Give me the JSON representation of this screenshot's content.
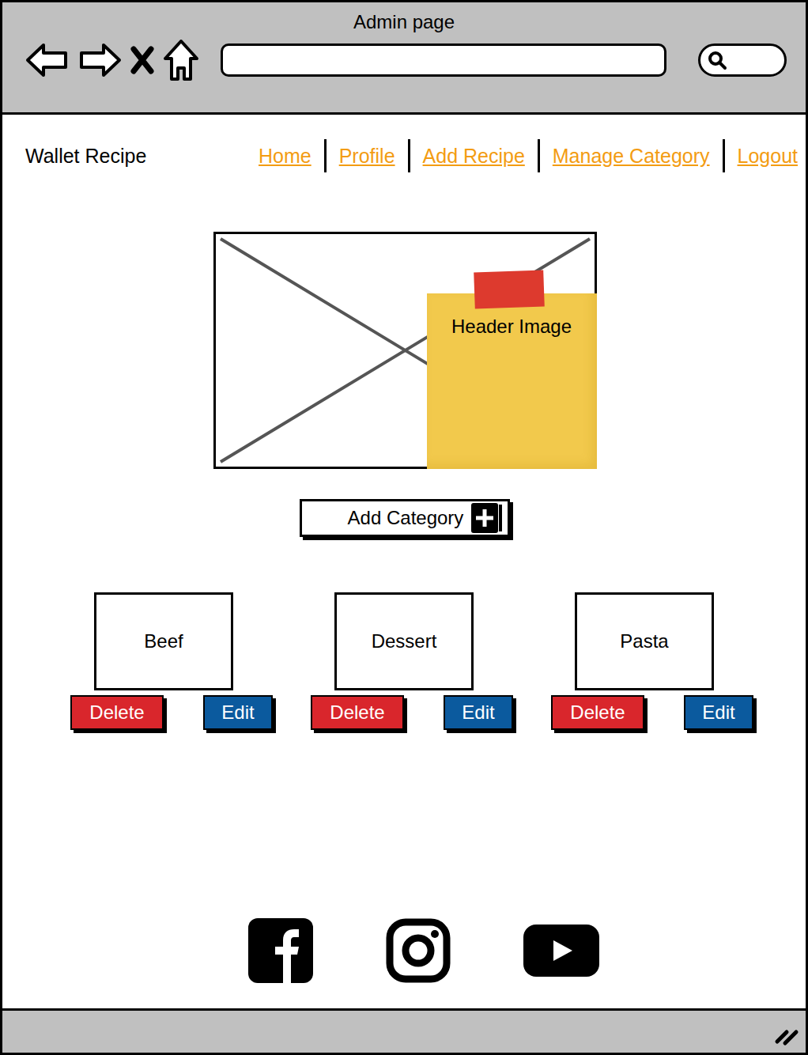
{
  "window": {
    "title": "Admin page"
  },
  "brand": "Wallet Recipe",
  "nav": [
    "Home",
    "Profile",
    "Add Recipe",
    "Manage Category",
    "Logout"
  ],
  "header_image": {
    "label": "Header Image"
  },
  "add_button": {
    "label": "Add Category"
  },
  "categories": [
    {
      "name": "Beef",
      "delete_label": "Delete",
      "edit_label": "Edit"
    },
    {
      "name": "Dessert",
      "delete_label": "Delete",
      "edit_label": "Edit"
    },
    {
      "name": "Pasta",
      "delete_label": "Delete",
      "edit_label": "Edit"
    }
  ]
}
